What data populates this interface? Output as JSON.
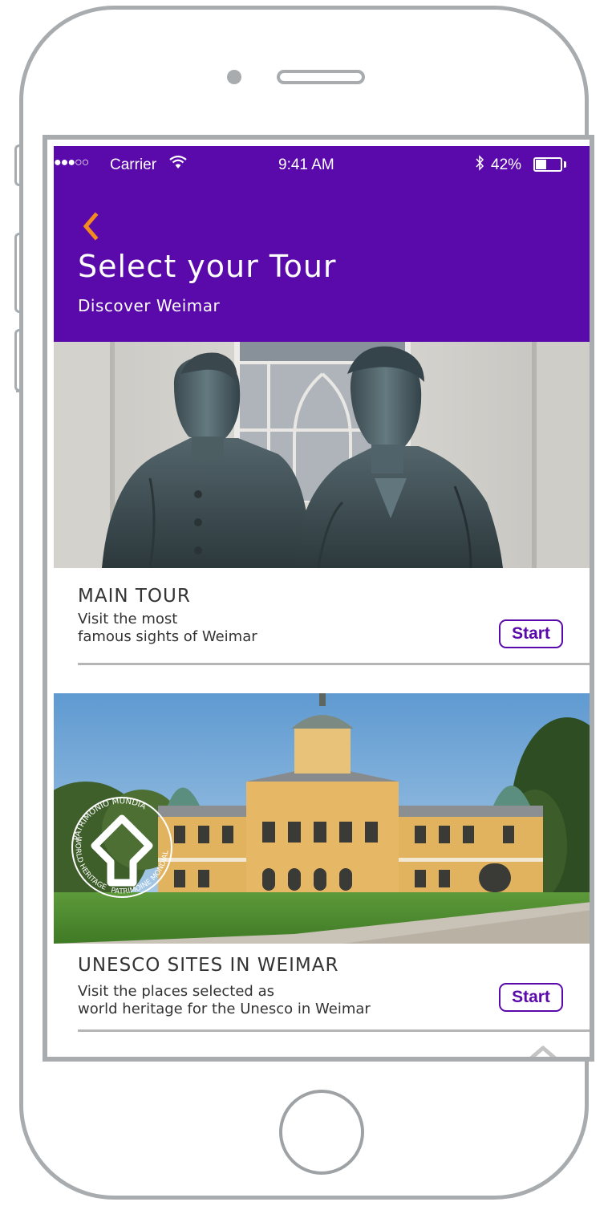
{
  "status_bar": {
    "signal": "●●●○○",
    "carrier": "Carrier",
    "time": "9:41 AM",
    "battery_percent": "42%",
    "battery_level": 0.42
  },
  "header": {
    "title": "Select your Tour",
    "subtitle": "Discover Weimar"
  },
  "tours": [
    {
      "title": "MAIN TOUR",
      "description": "Visit the most\nfamous sights of Weimar",
      "start_label": "Start"
    },
    {
      "title": "UNESCO SITES IN WEIMAR",
      "description": "Visit the places selected as\nworld heritage for the Unesco in Weimar",
      "start_label": "Start"
    }
  ],
  "unesco_emblem": {
    "text_top": "PATRIMONIO MUNDIAL",
    "text_left": "WORLD HERITAGE",
    "text_right": "PATRIMOINE MONDIAL"
  },
  "colors": {
    "header_bg": "#5a09aa",
    "accent": "#5a09aa",
    "back_arrow": "#f28c1e",
    "frame": "#a9acae"
  },
  "icons": {
    "back": "chevron-left-icon",
    "scroll_top": "chevron-up-icon",
    "wifi": "wifi-icon",
    "bluetooth": "bluetooth-icon",
    "battery": "battery-icon"
  }
}
